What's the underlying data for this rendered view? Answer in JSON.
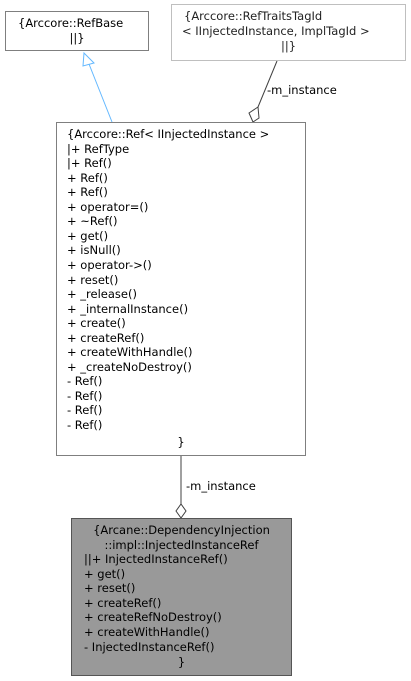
{
  "nodes": {
    "refbase": {
      "lines": [
        "{Arccore::RefBase",
        "||}"
      ]
    },
    "reftraits": {
      "lines": [
        "{Arccore::RefTraitsTagId",
        "< IInjectedInstance, ImplTagId >",
        "||}"
      ]
    },
    "ref": {
      "lines": [
        "{Arccore::Ref< IInjectedInstance >",
        "|+ RefType",
        "|+ Ref()",
        "+ Ref()",
        "+ Ref()",
        "+ operator=()",
        "+ ~Ref()",
        "+ get()",
        "+ isNull()",
        "+ operator->()",
        "+ reset()",
        "+ _release()",
        "+ _internalInstance()",
        "+ create()",
        "+ createRef()",
        "+ createWithHandle()",
        "+ _createNoDestroy()",
        "- Ref()",
        "- Ref()",
        "- Ref()",
        "- Ref()"
      ],
      "closing": "}"
    },
    "injected": {
      "title_lines": [
        "{Arcane::DependencyInjection",
        "::impl::InjectedInstanceRef"
      ],
      "lines": [
        "||+ InjectedInstanceRef()",
        "+ get()",
        "+ reset()",
        "+ createRef()",
        "+ createRefNoDestroy()",
        "+ createWithHandle()",
        "- InjectedInstanceRef()"
      ],
      "closing": "}"
    }
  },
  "edges": {
    "traits_to_ref": "-m_instance",
    "ref_to_injected": "-m_instance"
  },
  "colors": {
    "inherit_arrow": "#63b8ff",
    "composition": "#404040",
    "highlight_fill": "#999999"
  }
}
